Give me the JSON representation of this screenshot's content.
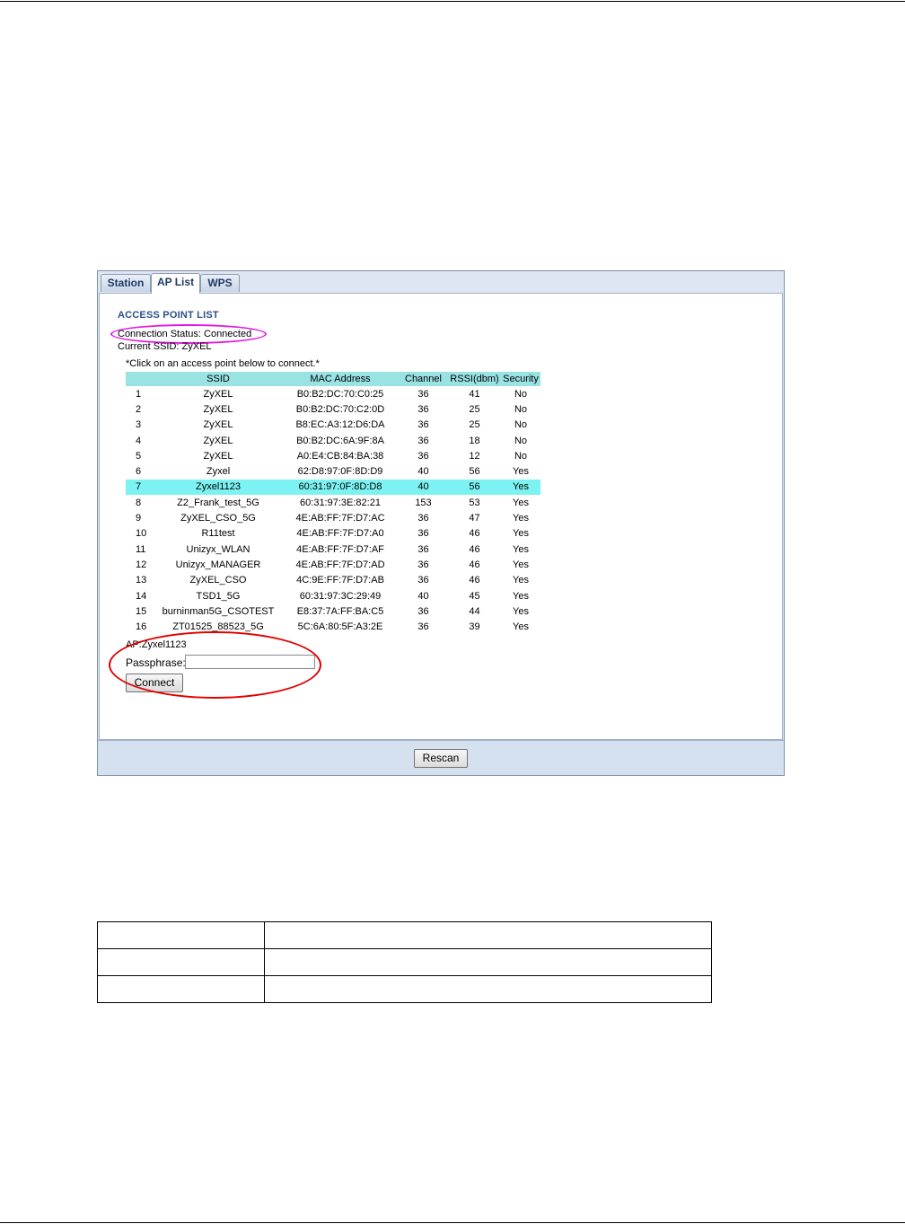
{
  "tabs": [
    {
      "label": "Station",
      "active": false
    },
    {
      "label": "AP List",
      "active": true
    },
    {
      "label": "WPS",
      "active": false
    }
  ],
  "section_title": "ACCESS POINT LIST",
  "connection_status": "Connection Status: Connected",
  "current_ssid": "Current SSID: ZyXEL",
  "instruction": "*Click on an access point below to connect.*",
  "ap_table": {
    "columns": [
      "",
      "SSID",
      "MAC Address",
      "Channel",
      "RSSI(dbm)",
      "Security"
    ],
    "rows": [
      [
        "1",
        "ZyXEL",
        "B0:B2:DC:70:C0:25",
        "36",
        "41",
        "No"
      ],
      [
        "2",
        "ZyXEL",
        "B0:B2:DC:70:C2:0D",
        "36",
        "25",
        "No"
      ],
      [
        "3",
        "ZyXEL",
        "B8:EC:A3:12:D6:DA",
        "36",
        "25",
        "No"
      ],
      [
        "4",
        "ZyXEL",
        "B0:B2:DC:6A:9F:8A",
        "36",
        "18",
        "No"
      ],
      [
        "5",
        "ZyXEL",
        "A0:E4:CB:84:BA:38",
        "36",
        "12",
        "No"
      ],
      [
        "6",
        "Zyxel",
        "62:D8:97:0F:8D:D9",
        "40",
        "56",
        "Yes"
      ],
      [
        "7",
        "Zyxel1123",
        "60:31:97:0F:8D:D8",
        "40",
        "56",
        "Yes"
      ],
      [
        "8",
        "Z2_Frank_test_5G",
        "60:31:97:3E:82:21",
        "153",
        "53",
        "Yes"
      ],
      [
        "9",
        "ZyXEL_CSO_5G",
        "4E:AB:FF:7F:D7:AC",
        "36",
        "47",
        "Yes"
      ],
      [
        "10",
        "R11test",
        "4E:AB:FF:7F:D7:A0",
        "36",
        "46",
        "Yes"
      ],
      [
        "11",
        "Unizyx_WLAN",
        "4E:AB:FF:7F:D7:AF",
        "36",
        "46",
        "Yes"
      ],
      [
        "12",
        "Unizyx_MANAGER",
        "4E:AB:FF:7F:D7:AD",
        "36",
        "46",
        "Yes"
      ],
      [
        "13",
        "ZyXEL_CSO",
        "4C:9E:FF:7F:D7:AB",
        "36",
        "46",
        "Yes"
      ],
      [
        "14",
        "TSD1_5G",
        "60:31:97:3C:29:49",
        "40",
        "45",
        "Yes"
      ],
      [
        "15",
        "burninman5G_CSOTEST",
        "E8:37:7A:FF:BA:C5",
        "36",
        "44",
        "Yes"
      ],
      [
        "16",
        "ZT01525_88523_5G",
        "5C:6A:80:5F:A3:2E",
        "36",
        "39",
        "Yes"
      ]
    ],
    "selected_row": 7
  },
  "selected_ap": "AP:Zyxel1123",
  "passphrase_label": "Passphrase:",
  "passphrase_value": "",
  "connect_label": "Connect",
  "rescan_label": "Rescan",
  "colors": {
    "header_bg": "#9ae3e3",
    "selected_row_bg": "#7df2f2",
    "status_highlight": "#e614e6",
    "connect_highlight": "#e00000",
    "title_color": "#2b4f87"
  }
}
